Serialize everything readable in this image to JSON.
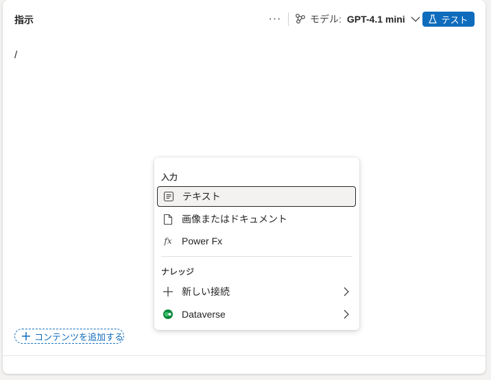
{
  "header": {
    "title": "指示",
    "more_label": "···",
    "model_label": "モデル:",
    "model_value": "GPT-4.1 mini",
    "test_label": "テスト"
  },
  "editor": {
    "text": "/"
  },
  "footer": {
    "add_content_label": "コンテンツを追加する"
  },
  "menu": {
    "input_section": "入力",
    "input_items": [
      {
        "label": "テキスト",
        "icon": "text-document-icon"
      },
      {
        "label": "画像またはドキュメント",
        "icon": "document-icon"
      },
      {
        "label": "Power Fx",
        "icon": "fx-icon",
        "glyph": "fx"
      }
    ],
    "knowledge_section": "ナレッジ",
    "knowledge_items": [
      {
        "label": "新しい接続",
        "icon": "plus-icon"
      },
      {
        "label": "Dataverse",
        "icon": "dataverse-icon"
      }
    ]
  },
  "colors": {
    "accent": "#0f6cbd",
    "dataverse_green": "#0b8a3e"
  }
}
